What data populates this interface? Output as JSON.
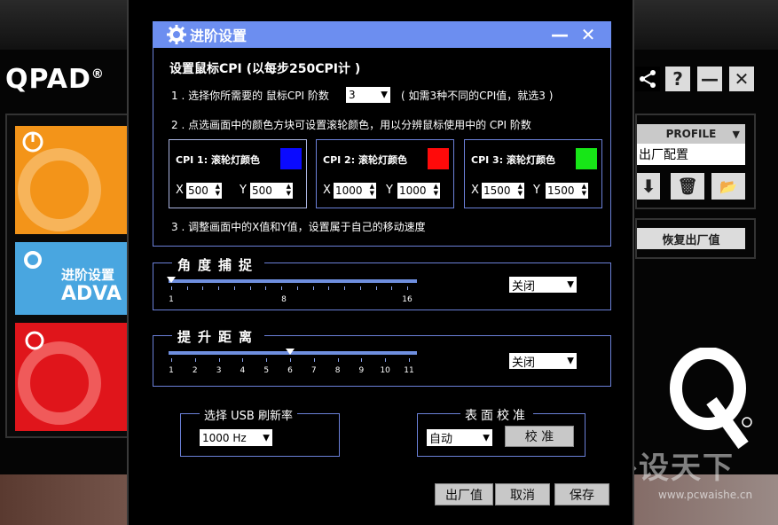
{
  "app": {
    "logo": "QPAD",
    "logo_mark": "®",
    "tiles": {
      "advanced_cn": "进阶设置",
      "advanced_en": "ADVA"
    },
    "profile": {
      "header": "PROFILE",
      "value": "出厂配置"
    },
    "restore_button": "恢复出厂值",
    "watermark": "外设天下",
    "watermark_url": "www.pcwaishe.cn"
  },
  "dialog": {
    "title": "进阶设置",
    "cpi_section": {
      "heading": "设置鼠标CPI (以每步250CPI计 )",
      "step1_prefix": "1 . 选择你所需要的 鼠标CPI 阶数",
      "step1_value": "3",
      "step1_suffix": "( 如需3种不同的CPI值，就选3 )",
      "step2": "2 . 点选画面中的颜色方块可设置滚轮颜色，用以分辨鼠标使用中的 CPI 阶数",
      "step3": "3 . 调整画面中的X值和Y值，设置属于自己的移动速度",
      "cpis": [
        {
          "label": "CPI 1: 滚轮灯颜色",
          "color": "#0a0aff",
          "x_label": "X",
          "x": "500",
          "y_label": "Y",
          "y": "500"
        },
        {
          "label": "CPI 2: 滚轮灯颜色",
          "color": "#ff0a0a",
          "x_label": "X",
          "x": "1000",
          "y_label": "Y",
          "y": "1000"
        },
        {
          "label": "CPI 3: 滚轮灯颜色",
          "color": "#17e617",
          "x_label": "X",
          "x": "1500",
          "y_label": "Y",
          "y": "1500"
        }
      ]
    },
    "angle_snap": {
      "legend": "角度捕捉",
      "tick_labels": [
        "1",
        "8",
        "16"
      ],
      "value": 1,
      "min": 1,
      "max": 16,
      "select": "关闭"
    },
    "lift_distance": {
      "legend": "提升距离",
      "tick_labels": [
        "1",
        "2",
        "3",
        "4",
        "5",
        "6",
        "7",
        "8",
        "9",
        "10",
        "11"
      ],
      "value": 6,
      "min": 1,
      "max": 11,
      "select": "关闭"
    },
    "usb_rate": {
      "legend": "选择 USB 刷新率",
      "select": "1000 Hz"
    },
    "surface": {
      "legend": "表面校准",
      "select": "自动",
      "button": "校 准"
    },
    "buttons": {
      "factory": "出厂值",
      "cancel": "取消",
      "save": "保存"
    }
  }
}
